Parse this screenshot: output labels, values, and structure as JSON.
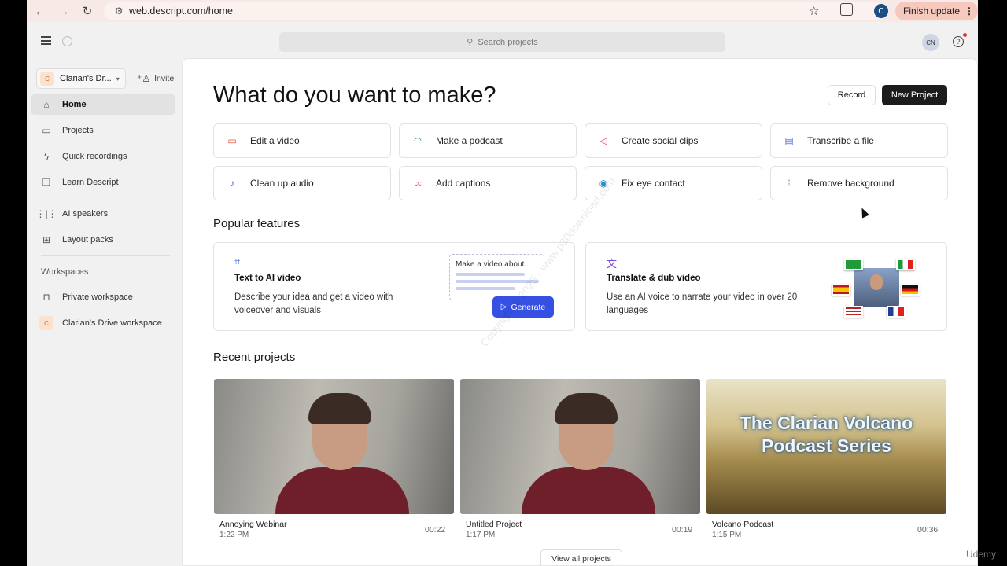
{
  "browser": {
    "url": "web.descript.com/home",
    "update_label": "Finish update",
    "profile_initial": "C"
  },
  "topbar": {
    "search_placeholder": "Search projects",
    "avatar_initials": "CN",
    "help_glyph": "?"
  },
  "sidebar": {
    "workspace_name": "Clarian's Dr...",
    "workspace_badge": "C",
    "invite_label": "Invite",
    "nav_items": [
      {
        "label": "Home",
        "icon": "home-icon",
        "glyph": "⌂",
        "active": true
      },
      {
        "label": "Projects",
        "icon": "folder-icon",
        "glyph": "▭"
      },
      {
        "label": "Quick recordings",
        "icon": "bolt-icon",
        "glyph": "ϟ"
      },
      {
        "label": "Learn Descript",
        "icon": "book-icon",
        "glyph": "❑"
      },
      {
        "label": "AI speakers",
        "icon": "waveform-icon",
        "glyph": "⋮|⋮"
      },
      {
        "label": "Layout packs",
        "icon": "grid-icon",
        "glyph": "⊞"
      }
    ],
    "workspaces_heading": "Workspaces",
    "workspaces": [
      {
        "label": "Private workspace",
        "icon": "lock-icon",
        "glyph": "🔒"
      },
      {
        "label": "Clarian's Drive workspace",
        "icon": "workspace-badge",
        "glyph": "C"
      }
    ]
  },
  "main": {
    "headline": "What do you want to make?",
    "record_label": "Record",
    "new_project_label": "New Project",
    "quick_actions": [
      {
        "label": "Edit a video",
        "icon": "video-camera-icon",
        "glyph": "▭",
        "color": "#e0533a"
      },
      {
        "label": "Make a podcast",
        "icon": "headphones-icon",
        "glyph": "◠",
        "color": "#2b9a55"
      },
      {
        "label": "Create social clips",
        "icon": "social-clip-icon",
        "glyph": "◁",
        "color": "#d4354a"
      },
      {
        "label": "Transcribe a file",
        "icon": "document-icon",
        "glyph": "▤",
        "color": "#4a6ad8"
      },
      {
        "label": "Clean up audio",
        "icon": "microphone-icon",
        "glyph": "♪",
        "color": "#7a49d8"
      },
      {
        "label": "Add captions",
        "icon": "captions-icon",
        "glyph": "cc",
        "color": "#d94a6a"
      },
      {
        "label": "Fix eye contact",
        "icon": "eye-icon",
        "glyph": "◉",
        "color": "#2a8fc9"
      },
      {
        "label": "Remove background",
        "icon": "remove-background-icon",
        "glyph": "⁞",
        "color": "#3a9a5a"
      }
    ],
    "popular_title": "Popular features",
    "features": [
      {
        "title": "Text to AI video",
        "desc": "Describe your idea and get a video with voiceover and visuals",
        "icon": "ai-video-icon"
      },
      {
        "title": "Translate & dub video",
        "desc": "Use an AI voice to narrate your video in over 20 languages",
        "icon": "translate-icon"
      }
    ],
    "prompt_text": "Make a video about...",
    "generate_label": "Generate",
    "recent_title": "Recent projects",
    "projects": [
      {
        "name": "Annoying Webinar",
        "time": "1:22 PM",
        "duration": "00:22"
      },
      {
        "name": "Untitled Project",
        "time": "1:17 PM",
        "duration": "00:19"
      },
      {
        "name": "Volcano Podcast",
        "time": "1:15 PM",
        "duration": "00:36",
        "overlay": "The Clarian Volcano Podcast Series"
      }
    ],
    "view_all_label": "View all projects"
  },
  "overlay": {
    "watermark": "Copyright © 2025 - www.p30download.com",
    "brand": "Udemy"
  }
}
